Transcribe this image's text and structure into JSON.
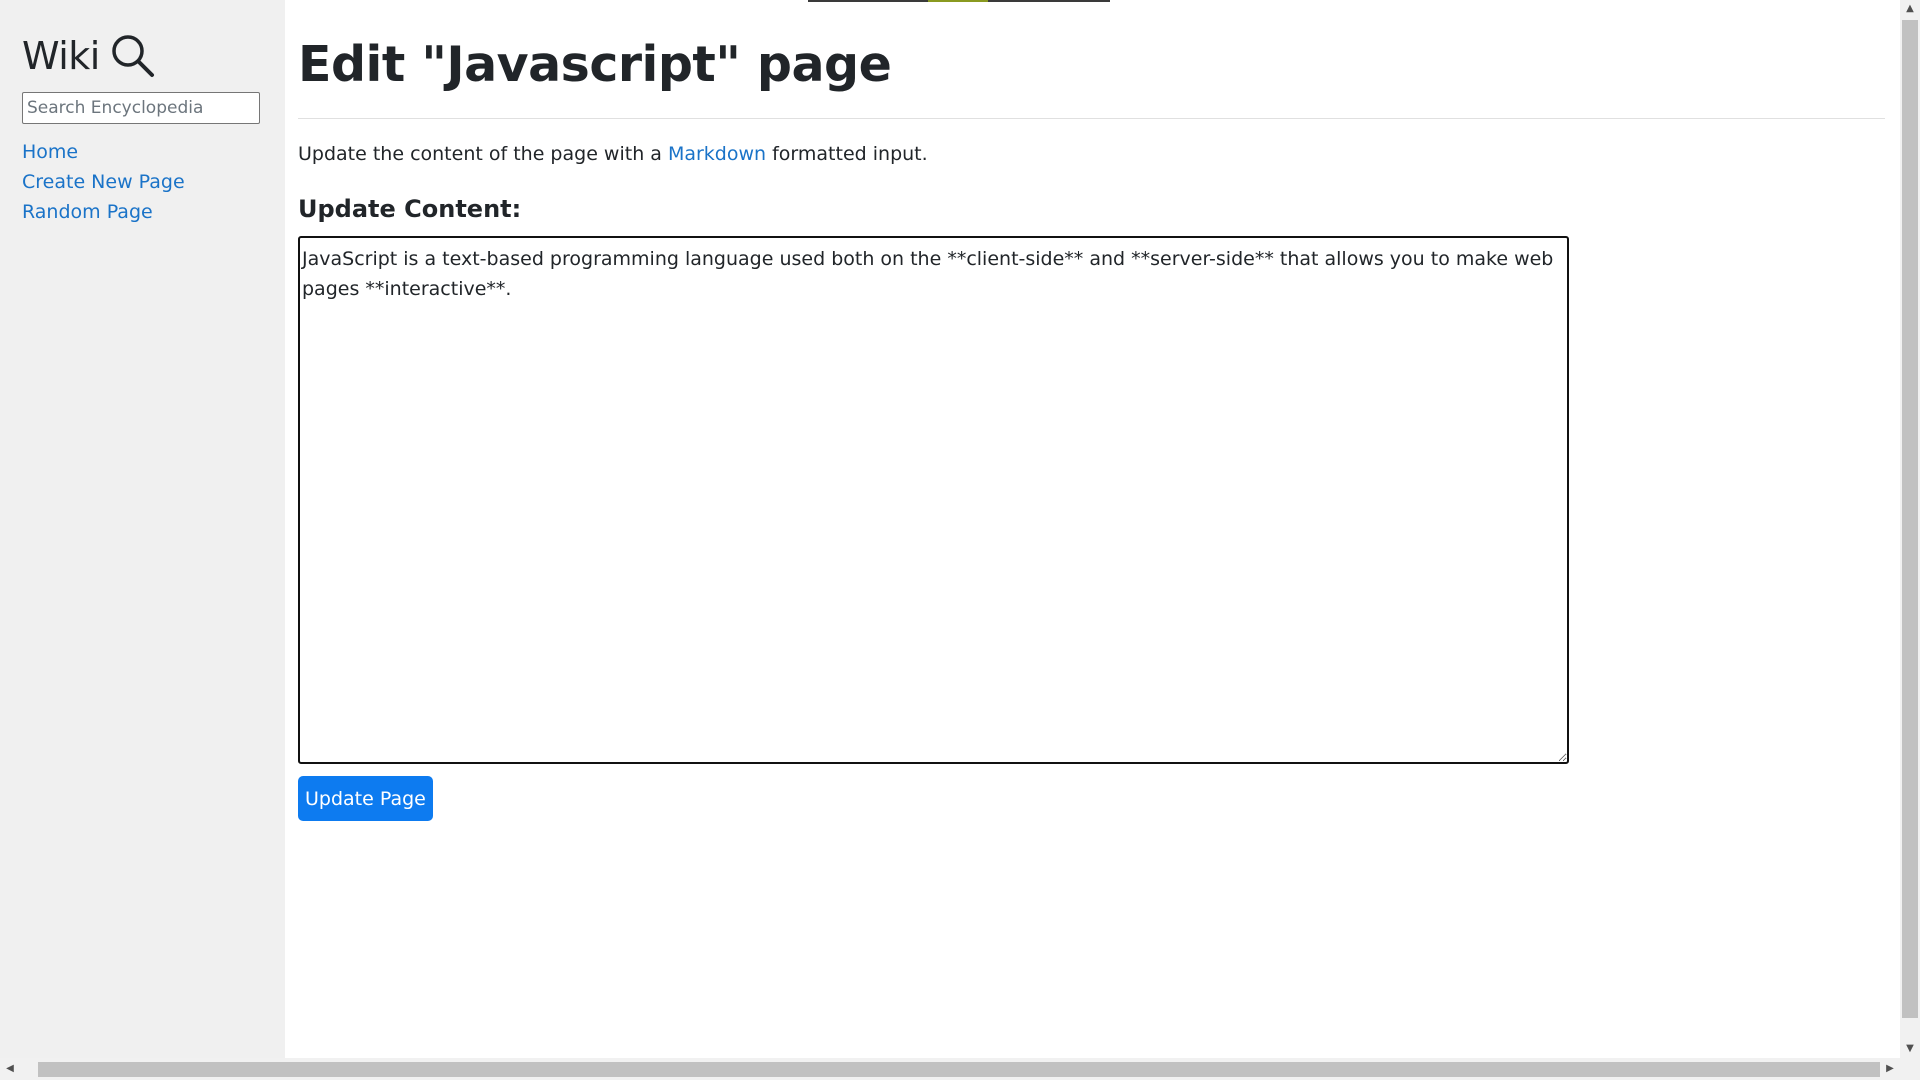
{
  "sidebar": {
    "brand_title": "Wiki",
    "brand_icon": "search-icon",
    "search_placeholder": "Search Encyclopedia",
    "search_value": "",
    "nav": [
      {
        "label": "Home"
      },
      {
        "label": "Create New Page"
      },
      {
        "label": "Random Page"
      }
    ]
  },
  "main": {
    "title": "Edit \"Javascript\" page",
    "intro_before": "Update the content of the page with a ",
    "intro_link": "Markdown",
    "intro_after": " formatted input.",
    "update_label": "Update Content:",
    "content_value": "JavaScript is a text-based programming language used both on the **client-side** and **server-side** that allows you to make web pages **interactive**.",
    "submit_label": "Update Page"
  },
  "colors": {
    "link": "#1a73c8",
    "button": "#0d7bf0",
    "sidebar_bg": "#f0f0f0"
  }
}
